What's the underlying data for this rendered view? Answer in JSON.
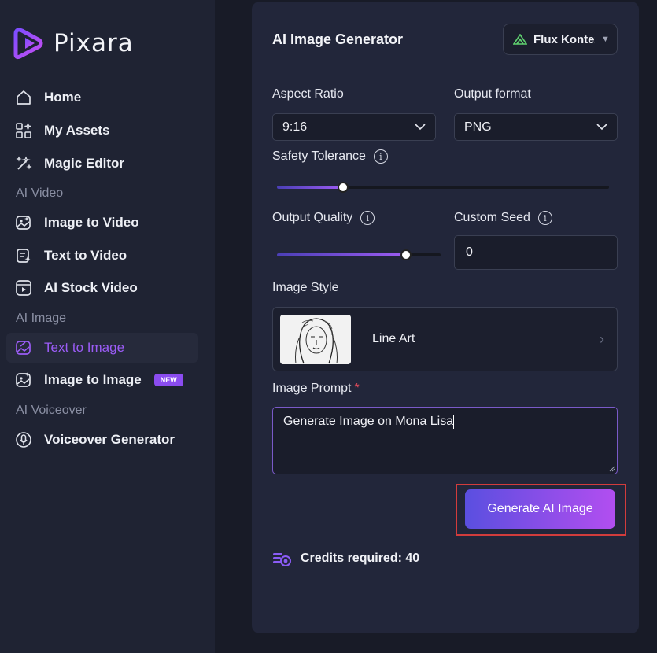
{
  "brand": {
    "name": "Pixara"
  },
  "nav": {
    "home": "Home",
    "assets": "My Assets",
    "magic": "Magic Editor",
    "section_video": "AI Video",
    "img2vid": "Image to Video",
    "txt2vid": "Text to Video",
    "stock": "AI Stock Video",
    "section_image": "AI Image",
    "txt2img": "Text to Image",
    "img2img": "Image to Image",
    "new_badge": "NEW",
    "section_voice": "AI Voiceover",
    "voice": "Voiceover Generator"
  },
  "panel": {
    "title": "AI Image Generator",
    "model": "Flux Kontext",
    "aspect_label": "Aspect Ratio",
    "aspect_value": "9:16",
    "format_label": "Output format",
    "format_value": "PNG",
    "safety_label": "Safety Tolerance",
    "safety_level": 0.2,
    "quality_label": "Output Quality",
    "quality_level": 0.79,
    "seed_label": "Custom Seed",
    "seed_value": "0",
    "style_label": "Image Style",
    "style_value": "Line Art",
    "prompt_label": "Image Prompt",
    "prompt_required": "*",
    "prompt_value": "Generate Image on Mona Lisa",
    "generate": "Generate AI Image",
    "credits": "Credits required: 40"
  },
  "colors": {
    "accent": "#9b5cf6",
    "highlight": "#d23c3c"
  }
}
